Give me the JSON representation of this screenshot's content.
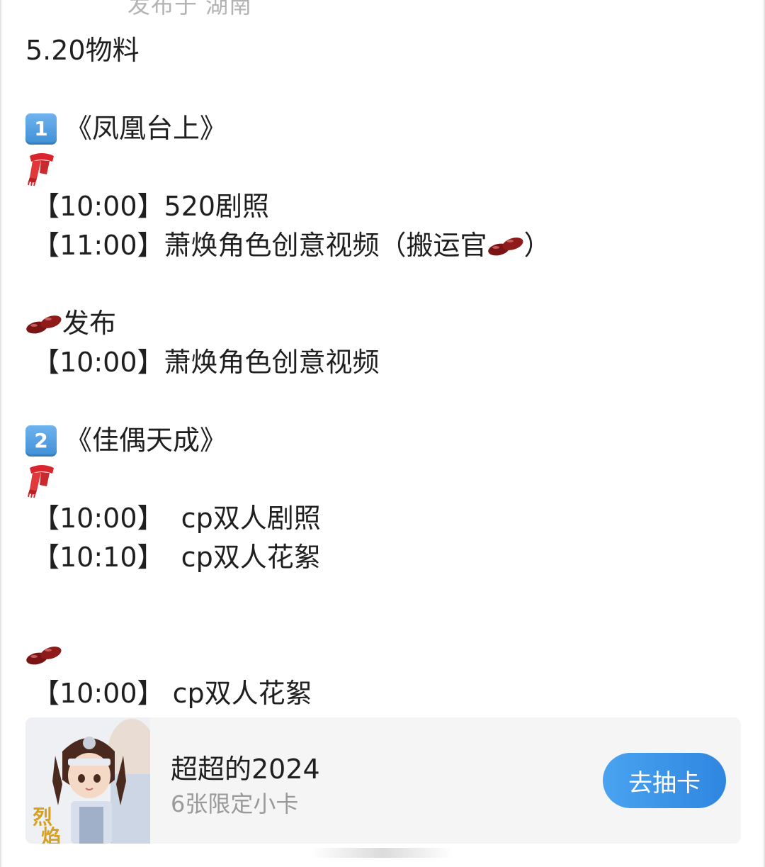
{
  "post": {
    "location_line": "发布于 湖南",
    "title": "5.20物料",
    "section1": {
      "badge": "1",
      "heading": "《凤凰台上》",
      "scarf_icon": "red-scarf-icon",
      "lines": [
        {
          "time": "【10:00】",
          "text": "520剧照"
        },
        {
          "time": "【11:00】",
          "text": "萧焕角色创意视频（搬运官",
          "suffix": "）",
          "bean_icon": "red-beans-icon"
        }
      ],
      "bean_heading": "发布",
      "bean_lines": [
        {
          "time": "【10:00】",
          "text": "萧焕角色创意视频"
        }
      ]
    },
    "section2": {
      "badge": "2",
      "heading": "《佳偶天成》",
      "scarf_icon": "red-scarf-icon",
      "lines": [
        {
          "time": "【10:00】",
          "text": "  cp双人剧照"
        },
        {
          "time": "【10:10】",
          "text": "  cp双人花絮"
        }
      ],
      "bean_lines": [
        {
          "time": "【10:00】",
          "text": " cp双人花絮"
        }
      ]
    }
  },
  "card": {
    "title": "超超的2024",
    "subtitle": "6张限定小卡",
    "button_label": "去抽卡",
    "thumbnail_logo": "烈焰",
    "accent_color": "#2f86e0"
  }
}
